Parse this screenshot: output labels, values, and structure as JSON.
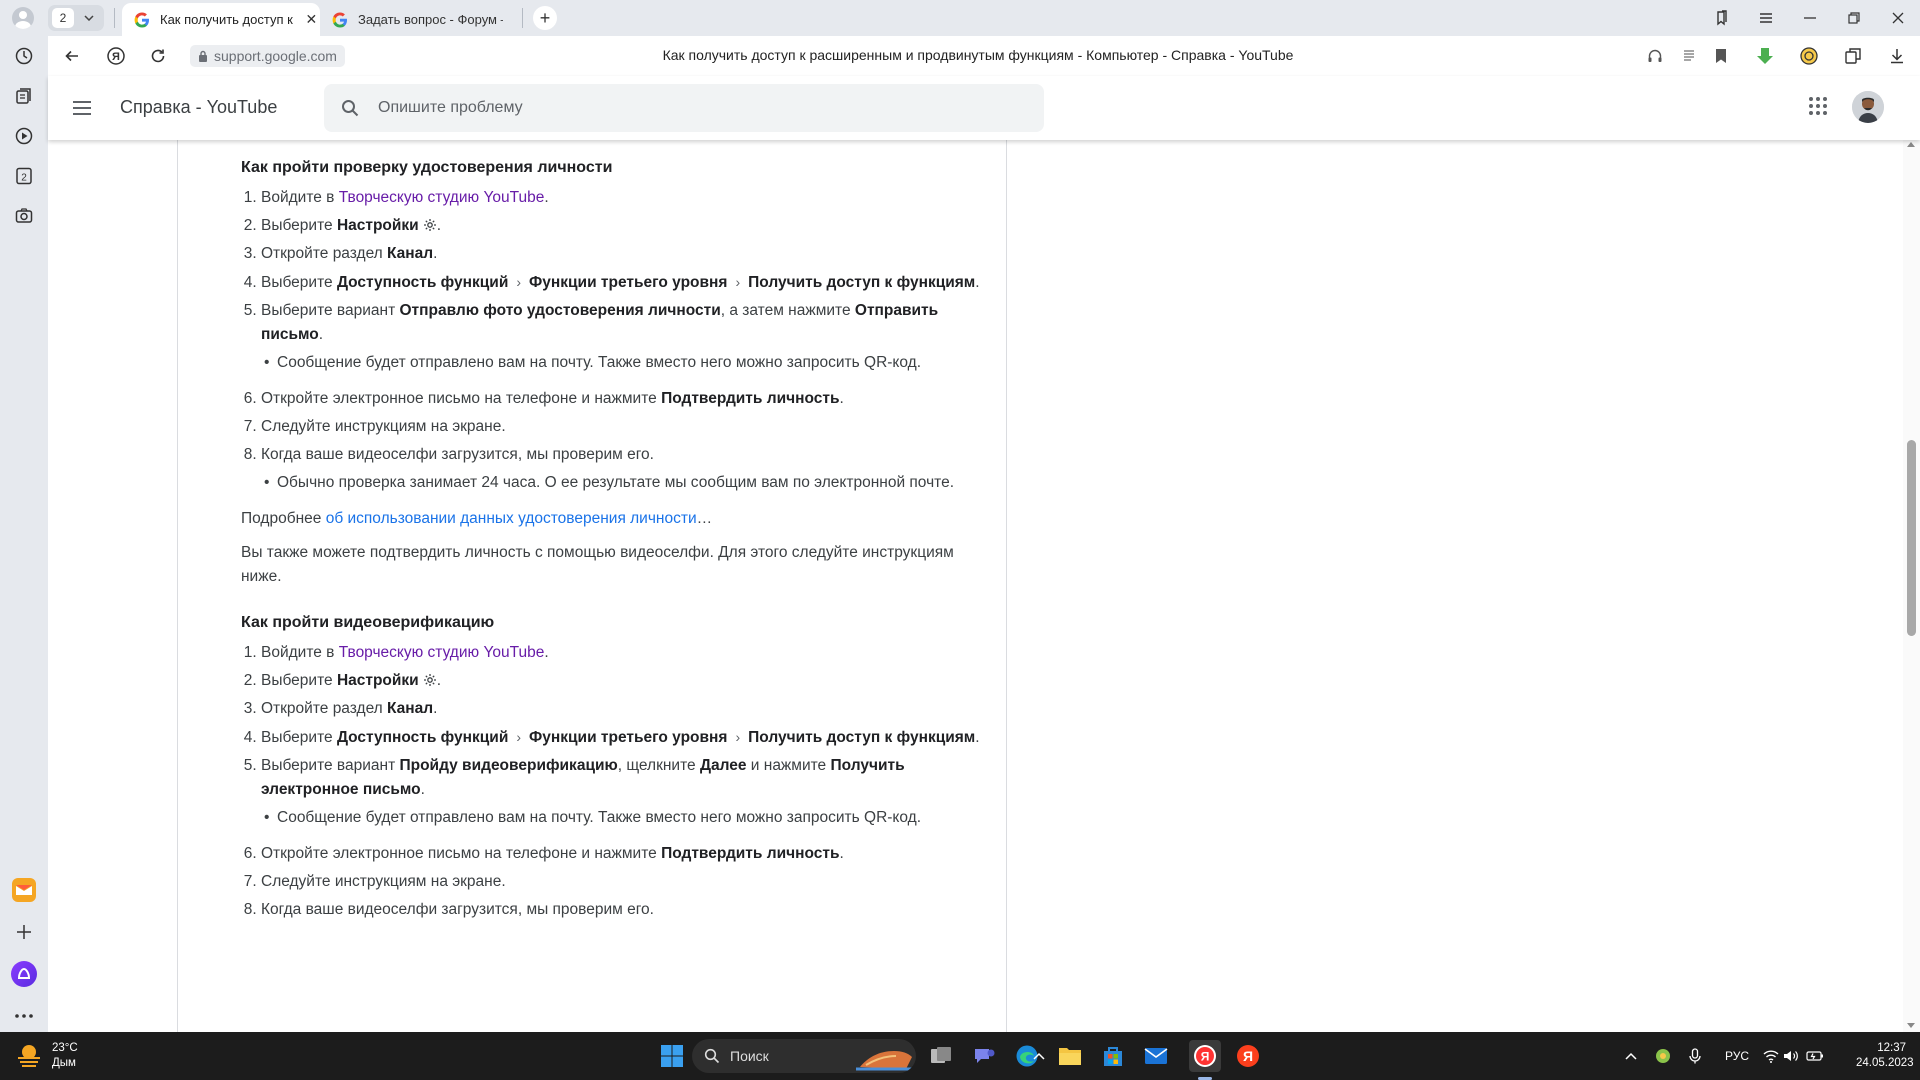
{
  "browser": {
    "tab_count": "2",
    "tabs": [
      {
        "title": "Как получить доступ к",
        "active": true
      },
      {
        "title": "Задать вопрос - Форум –",
        "active": false
      }
    ],
    "address": {
      "domain": "support.google.com",
      "page_title": "Как получить доступ к расширенным и продвинутым функциям - Компьютер - Справка - YouTube"
    }
  },
  "header": {
    "product_name": "Справка - YouTube",
    "search_placeholder": "Опишите проблему"
  },
  "article": {
    "section1": {
      "heading": "Как пройти проверку удостоверения личности",
      "step1": {
        "pre": "Войдите в ",
        "link": "Творческую студию YouTube",
        "post": "."
      },
      "step2": {
        "pre": "Выберите ",
        "bold": "Настройки",
        "post": "."
      },
      "step3": {
        "pre": "Откройте раздел ",
        "bold": "Канал",
        "post": "."
      },
      "step4": {
        "pre": "Выберите ",
        "b1": "Доступность функций",
        "b2": "Функции третьего уровня",
        "b3": "Получить доступ к функциям",
        "post": "."
      },
      "step5": {
        "pre": "Выберите вариант ",
        "b1": "Отправлю фото удостоверения личности",
        "mid": ", а затем нажмите ",
        "b2": "Отправить письмо",
        "post": "."
      },
      "step5_note": "Сообщение будет отправлено вам на почту. Также вместо него можно запросить QR-код.",
      "step6": {
        "pre": "Откройте электронное письмо на телефоне и нажмите ",
        "bold": "Подтвердить личность",
        "post": "."
      },
      "step7": "Следуйте инструкциям на экране.",
      "step8": "Когда ваше видеоселфи загрузится, мы проверим его.",
      "step8_note": "Обычно проверка занимает 24 часа. О ее результате мы сообщим вам по электронной почте."
    },
    "more": {
      "pre": "Подробнее ",
      "link": "об использовании данных удостоверения личности",
      "post": "…"
    },
    "video_intro": "Вы также можете подтвердить личность с помощью видеоселфи. Для этого следуйте инструкциям ниже.",
    "section2": {
      "heading": "Как пройти видеоверификацию",
      "step1": {
        "pre": "Войдите в ",
        "link": "Творческую студию YouTube",
        "post": "."
      },
      "step2": {
        "pre": "Выберите ",
        "bold": "Настройки",
        "post": "."
      },
      "step3": {
        "pre": "Откройте раздел ",
        "bold": "Канал",
        "post": "."
      },
      "step4": {
        "pre": "Выберите ",
        "b1": "Доступность функций",
        "b2": "Функции третьего уровня",
        "b3": "Получить доступ к функциям",
        "post": "."
      },
      "step5": {
        "pre": "Выберите вариант ",
        "b1": "Пройду видеоверификацию",
        "mid1": ", щелкните ",
        "b2": "Далее",
        "mid2": " и нажмите ",
        "b3": "Получить электронное письмо",
        "post": "."
      },
      "step5_note": "Сообщение будет отправлено вам на почту. Также вместо него можно запросить QR-код.",
      "step6": {
        "pre": "Откройте электронное письмо на телефоне и нажмите ",
        "bold": "Подтвердить личность",
        "post": "."
      },
      "step7": "Следуйте инструкциям на экране.",
      "step8": "Когда ваше видеоселфи загрузится, мы проверим его."
    }
  },
  "taskbar": {
    "weather_temp": "23°C",
    "weather_desc": "Дым",
    "search_label": "Поиск",
    "language": "РУС",
    "time": "12:37",
    "date": "24.05.2023"
  },
  "colors": {
    "link": "#1a73e8",
    "visited_link": "#681da8",
    "chrome_bg": "#e6e9ee",
    "taskbar_bg": "#1c1c1c"
  },
  "icons": [
    "profile-icon",
    "chevron-down-icon",
    "google-favicon",
    "close-icon",
    "plus-icon",
    "bookmarks-icon",
    "menu-icon",
    "minimize-icon",
    "restore-icon",
    "close-window-icon",
    "history-icon",
    "collections-icon",
    "video-icon",
    "tabs-count-icon",
    "screenshot-icon",
    "mail-icon",
    "alice-icon",
    "more-icon",
    "back-icon",
    "yandex-icon",
    "reload-icon",
    "lock-icon",
    "headphones-icon",
    "reader-icon",
    "bookmark-icon",
    "download-icon",
    "search-icon",
    "apps-grid-icon",
    "settings-gear-icon",
    "windows-start-icon"
  ]
}
